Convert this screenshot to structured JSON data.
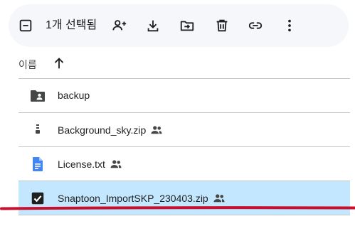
{
  "toolbar": {
    "selection_count": "1개 선택됨",
    "buttons": [
      {
        "name": "deselect-icon"
      },
      {
        "name": "share-icon"
      },
      {
        "name": "download-icon"
      },
      {
        "name": "move-icon"
      },
      {
        "name": "delete-icon"
      },
      {
        "name": "link-icon"
      },
      {
        "name": "more-icon"
      }
    ]
  },
  "sort": {
    "label": "이름",
    "direction": "ascending"
  },
  "files": [
    {
      "name": "backup",
      "type": "shared-folder",
      "shared": false,
      "selected": false
    },
    {
      "name": "Background_sky.zip",
      "type": "zip",
      "shared": true,
      "selected": false
    },
    {
      "name": "License.txt",
      "type": "doc",
      "shared": true,
      "selected": false
    },
    {
      "name": "Snaptoon_ImportSKP_230403.zip",
      "type": "zip",
      "shared": true,
      "selected": true
    }
  ],
  "colors": {
    "selected_row": "#c2e7ff",
    "annotation_line": "#c8102e",
    "doc_icon": "#4285f4",
    "icon_gray": "#444746"
  }
}
